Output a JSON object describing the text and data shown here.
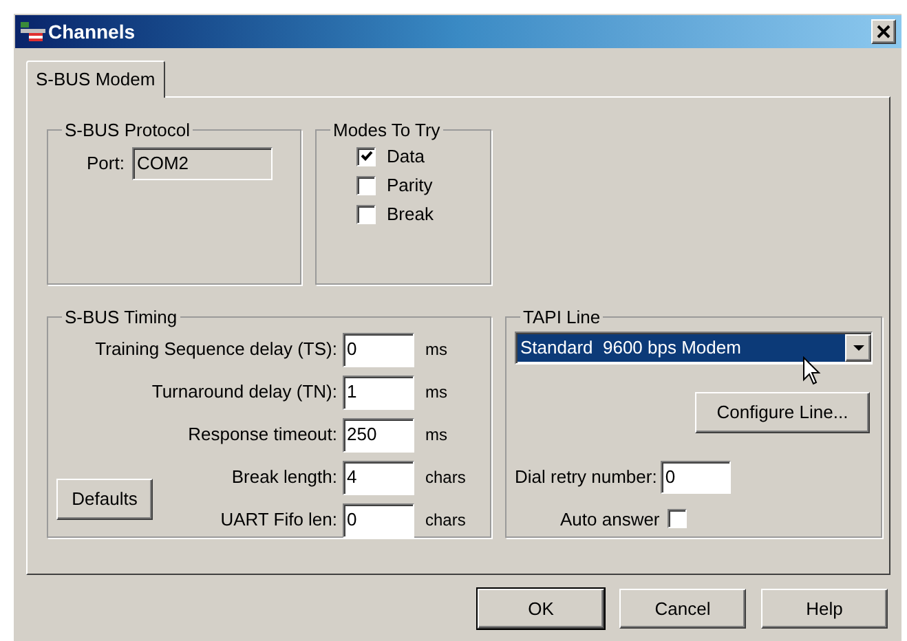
{
  "window": {
    "title": "Channels"
  },
  "tabs": [
    {
      "label": "S-BUS Modem",
      "selected": true
    }
  ],
  "protocol": {
    "title": "S-BUS Protocol",
    "port_label": "Port:",
    "port_value": "COM2"
  },
  "modes": {
    "title": "Modes To Try",
    "options": [
      {
        "label": "Data",
        "checked": true
      },
      {
        "label": "Parity",
        "checked": false
      },
      {
        "label": "Break",
        "checked": false
      }
    ]
  },
  "timing": {
    "title": "S-BUS Timing",
    "defaults_button": "Defaults",
    "fields": [
      {
        "label": "Training Sequence delay (TS):",
        "value": "0",
        "unit": "ms"
      },
      {
        "label": "Turnaround delay (TN):",
        "value": "1",
        "unit": "ms"
      },
      {
        "label": "Response timeout:",
        "value": "250",
        "unit": "ms"
      },
      {
        "label": "Break length:",
        "value": "4",
        "unit": "chars"
      },
      {
        "label": "UART Fifo len:",
        "value": "0",
        "unit": "chars"
      }
    ]
  },
  "tapi": {
    "title": "TAPI Line",
    "line": "Standard  9600 bps Modem",
    "configure_button": "Configure Line...",
    "dial_retry_label": "Dial retry number:",
    "dial_retry_value": "0",
    "auto_answer_label": "Auto answer",
    "auto_answer": false
  },
  "buttons": [
    {
      "label": "OK",
      "default": true
    },
    {
      "label": "Cancel",
      "default": false
    },
    {
      "label": "Help",
      "default": false
    }
  ]
}
